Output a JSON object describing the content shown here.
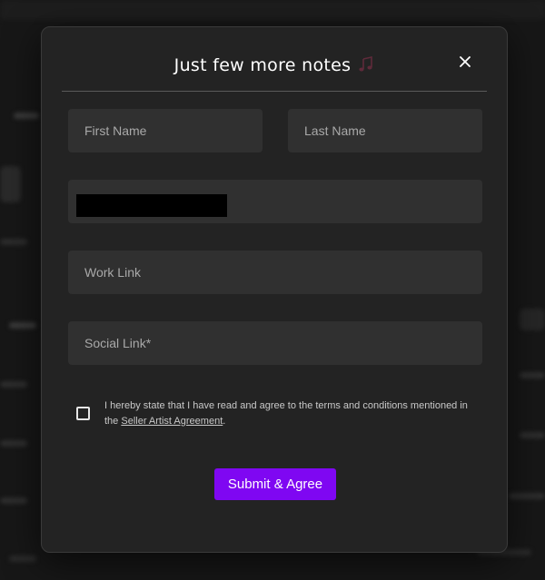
{
  "modal": {
    "title": "Just few more notes",
    "title_icon": "musical-notes-icon",
    "close_icon": "close-icon"
  },
  "form": {
    "first_name_placeholder": "First Name",
    "last_name_placeholder": "Last Name",
    "email_value": "",
    "work_link_placeholder": "Work Link",
    "social_link_placeholder": "Social Link*",
    "agreement": {
      "text_before": "I hereby state that I have read and agree to the terms and conditions mentioned in the ",
      "link_text": "Seller Artist Agreement",
      "text_after": ".",
      "checked": false
    },
    "submit_label": "Submit & Agree"
  },
  "colors": {
    "accent": "#7f07f2",
    "modal_bg": "#232323",
    "field_bg": "#303030",
    "backdrop": "#171717"
  }
}
